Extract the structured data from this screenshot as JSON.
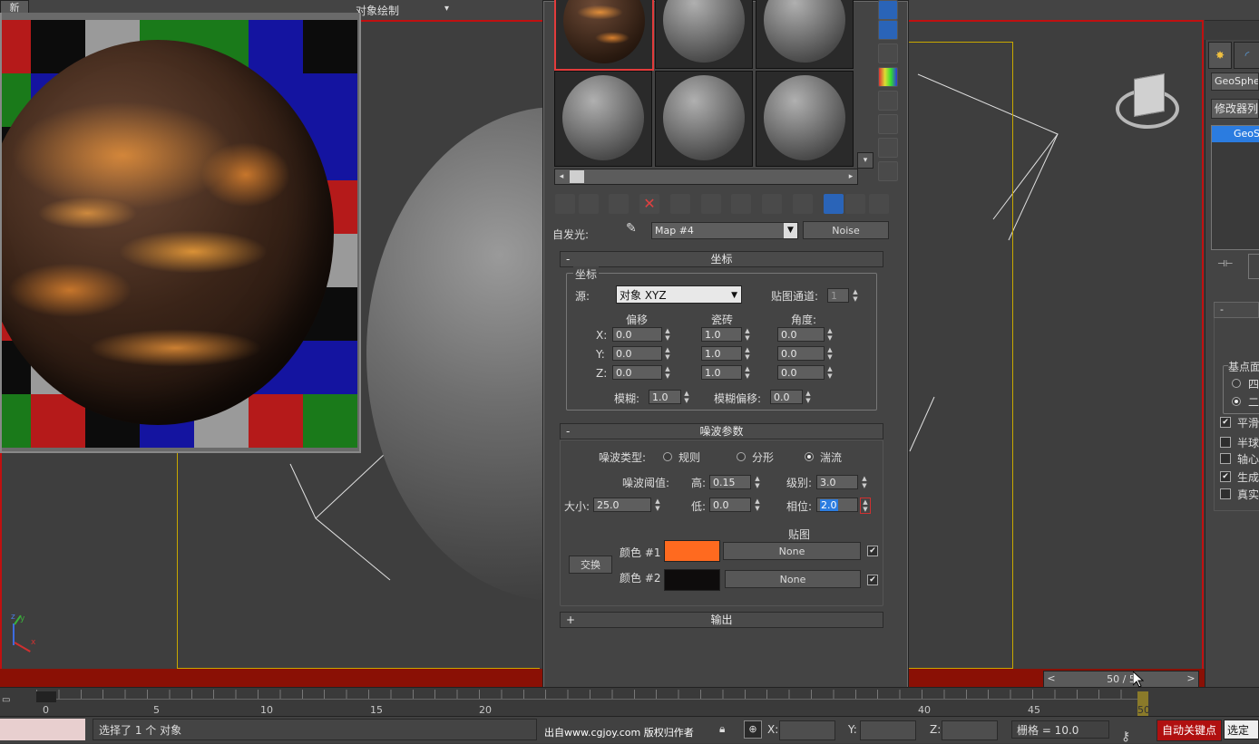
{
  "top": {
    "tab_label": "新",
    "viewport_menu": "对象绘制",
    "dropdown_glyph": "▾"
  },
  "viewport": {
    "nav_prev": "<",
    "nav_next": ">",
    "frame_counter": "50 / 5",
    "axis_x": "x",
    "axis_y": "y"
  },
  "material_editor": {
    "slot_scroll_left": "◂",
    "slot_scroll_right": "▸",
    "slot_scroll_down": "▾",
    "self_illum_label": "自发光:",
    "map_name": "Map #4",
    "map_type_button": "Noise",
    "coords_rollout": {
      "toggle": "-",
      "title": "坐标",
      "group_label": "坐标",
      "source_label": "源:",
      "source_value": "对象 XYZ",
      "map_channel_label": "贴图通道:",
      "map_channel_value": "1",
      "offset_label": "偏移",
      "tiling_label": "瓷砖",
      "angle_label": "角度:",
      "rows": [
        {
          "axis": "X:",
          "offset": "0.0",
          "tiling": "1.0",
          "angle": "0.0"
        },
        {
          "axis": "Y:",
          "offset": "0.0",
          "tiling": "1.0",
          "angle": "0.0"
        },
        {
          "axis": "Z:",
          "offset": "0.0",
          "tiling": "1.0",
          "angle": "0.0"
        }
      ],
      "blur_label": "模糊:",
      "blur_value": "1.0",
      "blur_offset_label": "模糊偏移:",
      "blur_offset_value": "0.0"
    },
    "noise_rollout": {
      "toggle": "-",
      "title": "噪波参数",
      "type_label": "噪波类型:",
      "type_regular": "规则",
      "type_fractal": "分形",
      "type_turbulence": "湍流",
      "type_selected": "湍流",
      "threshold_label": "噪波阈值:",
      "high_label": "高:",
      "high_value": "0.15",
      "levels_label": "级别:",
      "levels_value": "3.0",
      "size_label": "大小:",
      "size_value": "25.0",
      "low_label": "低:",
      "low_value": "0.0",
      "phase_label": "相位:",
      "phase_value": "2.0",
      "maps_label": "贴图",
      "swap_button": "交换",
      "color1_label": "颜色 #1",
      "color1": "#ff6a1f",
      "color1_map": "None",
      "color2_label": "颜色 #2",
      "color2": "#0e0c0c",
      "color2_map": "None"
    },
    "output_rollout": {
      "toggle": "+",
      "title": "输出"
    }
  },
  "command_panel": {
    "object_name": "GeoSpher",
    "modifier_list": "修改器列",
    "stack_item": "GeoS",
    "rollout_toggle": "-",
    "base_point_label": "基点面",
    "radio1": "四",
    "radio2": "二",
    "checks": [
      {
        "label": "平滑",
        "checked": true
      },
      {
        "label": "半球",
        "checked": false
      },
      {
        "label": "轴心",
        "checked": false
      },
      {
        "label": "生成",
        "checked": true
      },
      {
        "label": "真实",
        "checked": false
      }
    ]
  },
  "timeline": {
    "ticks": [
      "0",
      "5",
      "10",
      "15",
      "20",
      "40",
      "45",
      "50"
    ]
  },
  "status": {
    "selection_text": "选择了 1 个 对象",
    "watermark": "出自www.cgjoy.com 版权归作者",
    "x_label": "X:",
    "y_label": "Y:",
    "z_label": "Z:",
    "grid_text": "栅格 = 10.0",
    "autokey_button": "自动关键点",
    "setkey_button": "选定对"
  }
}
